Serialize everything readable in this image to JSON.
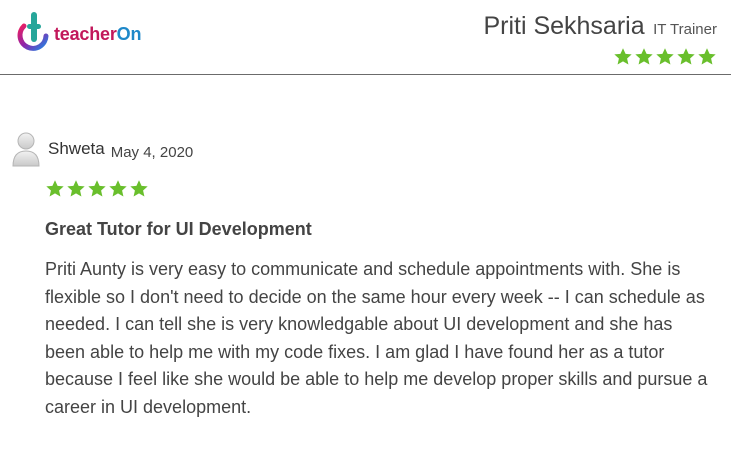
{
  "header": {
    "logo": {
      "part1": "teacher",
      "part2": "On",
      "colors": {
        "pink": "#c2185b",
        "blue": "#1e88c9",
        "green": "#26a69a"
      }
    },
    "tutor": {
      "name": "Priti Sekhsaria",
      "role": "IT Trainer",
      "rating": 5,
      "max_rating": 5
    }
  },
  "review": {
    "reviewer": "Shweta",
    "date": "May 4, 2020",
    "rating": 5,
    "max_rating": 5,
    "title": "Great Tutor for UI Development",
    "body": "Priti Aunty is very easy to communicate and schedule appointments with. She is flexible so I don't need to decide on the same hour every week -- I can schedule as needed. I can tell she is very knowledgable about UI development and she has been able to help me with my code fixes. I am glad I have found her as a tutor because I feel like she would be able to help me develop proper skills and pursue a career in UI development."
  },
  "icons": {
    "star": "star-icon",
    "avatar": "user-avatar-icon"
  },
  "colors": {
    "star_green": "#69bf2c",
    "divider": "#6b6b6b",
    "text": "#444444"
  }
}
